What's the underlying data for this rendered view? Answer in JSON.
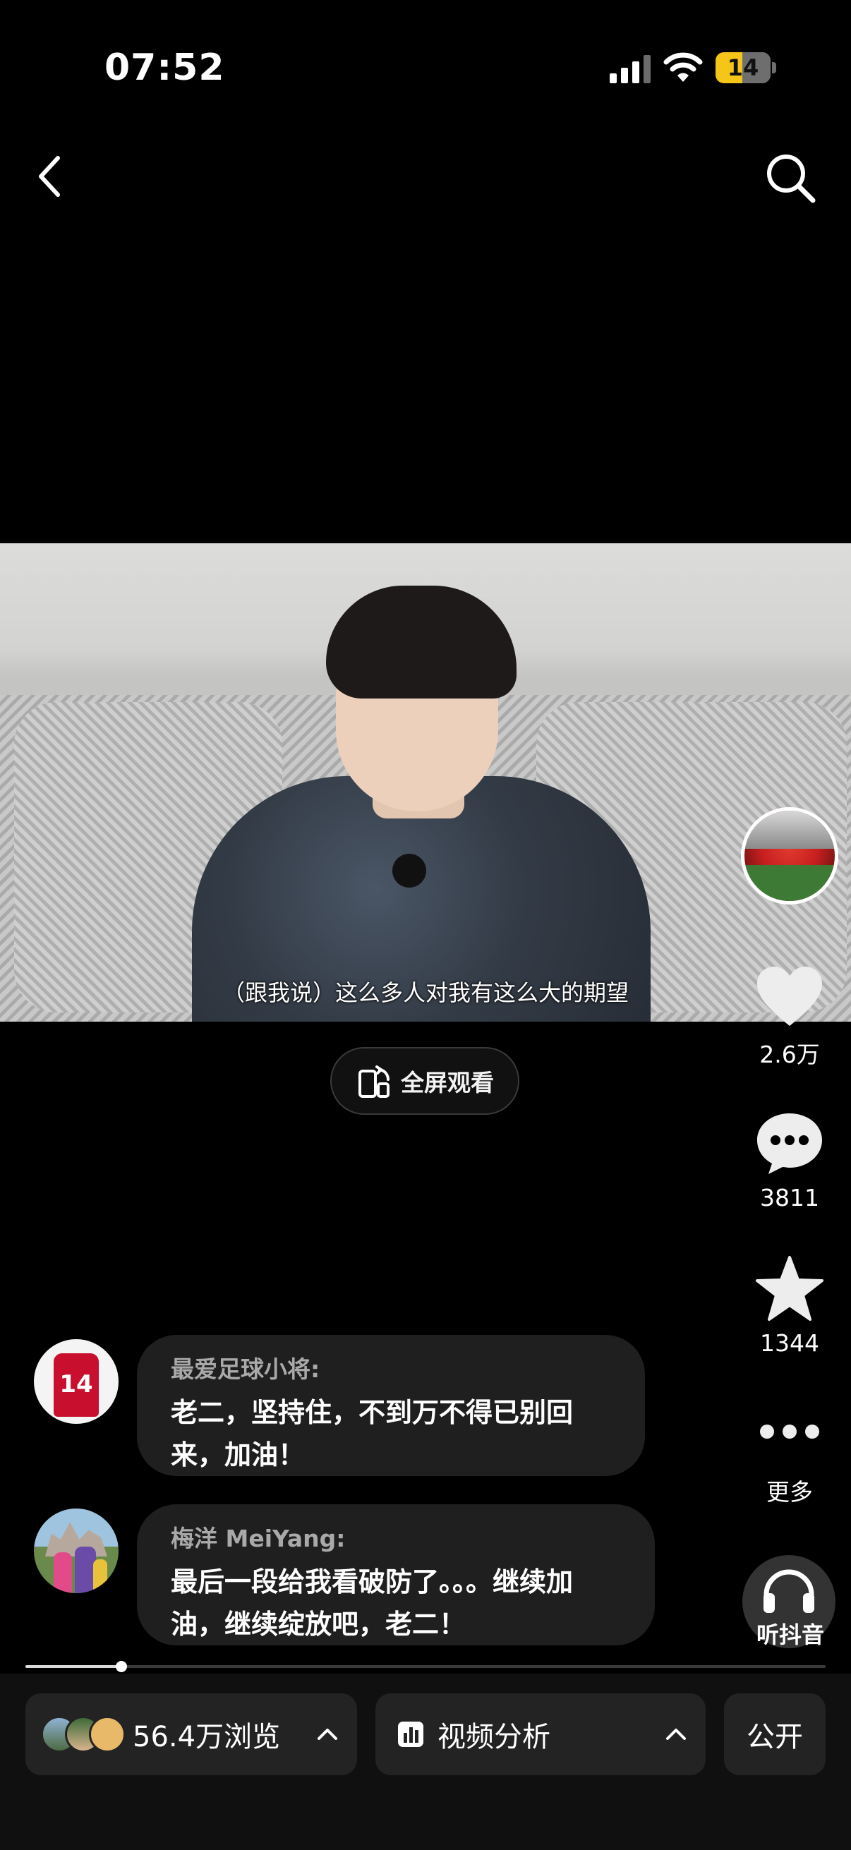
{
  "status_bar": {
    "time": "07:52",
    "battery": "14"
  },
  "video": {
    "subtitle": "（跟我说）这么多人对我有这么大的期望"
  },
  "fullscreen": {
    "label": "全屏观看"
  },
  "actions": {
    "likes": "2.6万",
    "comments": "3811",
    "favorites": "1344",
    "more_label": "更多",
    "listen_label": "听抖音"
  },
  "comments": [
    {
      "author": "最爱足球小将:",
      "text_line1": "老二，坚持住，不到万不得已别回",
      "text_line2": "来，加油！",
      "avatar_number": "14"
    },
    {
      "author": "梅洋 MeiYang:",
      "text_line1": "最后一段给我看破防了。。。继续加",
      "text_line2": "油，继续绽放吧，老二！"
    }
  ],
  "progress": {
    "fraction": 0.12
  },
  "bottom": {
    "views": "56.4万浏览",
    "analysis": "视频分析",
    "visibility": "公开"
  },
  "colors": {
    "background": "#000000",
    "bubble": "#1f1f1f",
    "battery": "#f5c518",
    "pill": "#232323"
  }
}
